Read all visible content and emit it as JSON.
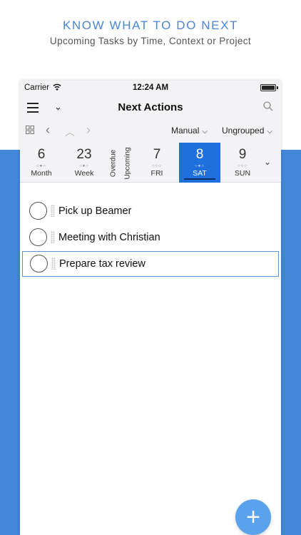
{
  "promo": {
    "headline": "KNOW WHAT TO DO NEXT",
    "subheadline": "Upcoming Tasks by Time, Context or Project"
  },
  "status_bar": {
    "carrier": "Carrier",
    "time": "12:24 AM"
  },
  "nav_bar": {
    "title": "Next Actions",
    "left_icons": [
      "hamburger-icon",
      "chevron-down-icon"
    ],
    "right_icon": "search-icon"
  },
  "toolbar": {
    "icons": [
      "grid-icon",
      "chevron-left-icon",
      "chevron-up-icon",
      "chevron-right-icon"
    ],
    "sort_label": "Manual",
    "group_label": "Ungrouped",
    "dropdown_glyph": "⌵"
  },
  "day_strip": {
    "month": {
      "num": "6",
      "label": "Month",
      "dots": "○●○"
    },
    "week": {
      "num": "23",
      "label": "Week",
      "dots": "○●○"
    },
    "overdue_label": "Overdue",
    "upcoming_label": "Upcoming",
    "fri": {
      "num": "7",
      "label": "FRI",
      "dots": "○○○"
    },
    "sat": {
      "num": "8",
      "label": "SAT",
      "dots": "○●○"
    },
    "sun": {
      "num": "9",
      "label": "SUN",
      "dots": "○○○"
    },
    "selected": "SAT",
    "selected_color": "#1f6fdc"
  },
  "tasks": [
    {
      "title": "Pick up Beamer"
    },
    {
      "title": "Meeting with Christian"
    },
    {
      "title": "Prepare tax review"
    }
  ],
  "active_task_index": 2,
  "fab_icon": "plus-icon",
  "fab_symbol": "+",
  "colors": {
    "accent_blue": "#4287d7",
    "headline_blue": "#4a86d2",
    "fab_blue": "#5aa2ec"
  }
}
